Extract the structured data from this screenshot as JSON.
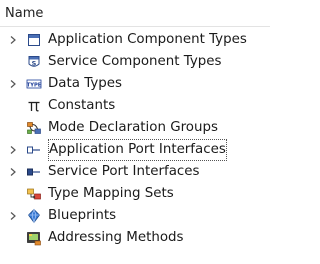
{
  "header": {
    "name_label": "Name"
  },
  "tree": {
    "items": [
      {
        "label": "Application Component Types",
        "expandable": true,
        "icon": "component-type-icon"
      },
      {
        "label": "Service Component Types",
        "expandable": false,
        "icon": "service-component-icon"
      },
      {
        "label": "Data Types",
        "expandable": true,
        "icon": "data-types-icon"
      },
      {
        "label": "Constants",
        "expandable": false,
        "icon": "pi-constants-icon"
      },
      {
        "label": "Mode Declaration Groups",
        "expandable": false,
        "icon": "mode-declaration-icon"
      },
      {
        "label": "Application Port Interfaces",
        "expandable": true,
        "icon": "application-port-icon",
        "focused": true
      },
      {
        "label": "Service Port Interfaces",
        "expandable": true,
        "icon": "service-port-icon"
      },
      {
        "label": "Type Mapping Sets",
        "expandable": false,
        "icon": "type-mapping-icon"
      },
      {
        "label": "Blueprints",
        "expandable": true,
        "icon": "blueprints-icon"
      },
      {
        "label": "Addressing Methods",
        "expandable": false,
        "icon": "addressing-methods-icon"
      }
    ],
    "typedef_icon_text": "TYPE"
  }
}
